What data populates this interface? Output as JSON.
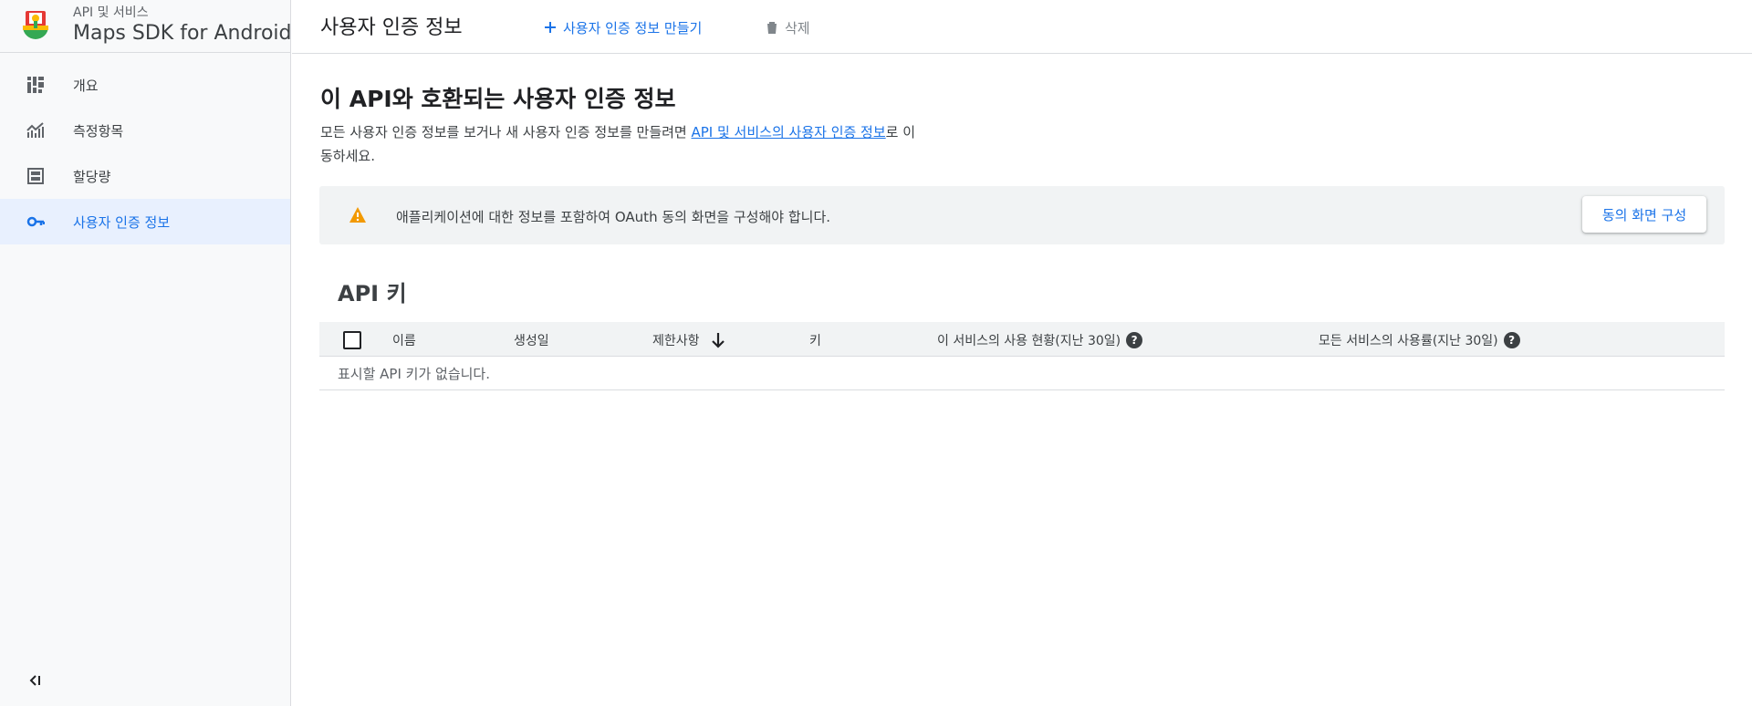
{
  "sidebar": {
    "kicker": "API 및 서비스",
    "title": "Maps SDK for Android",
    "items": [
      {
        "label": "개요",
        "icon": "dashboard-icon",
        "active": false
      },
      {
        "label": "측정항목",
        "icon": "metrics-icon",
        "active": false
      },
      {
        "label": "할당량",
        "icon": "quota-icon",
        "active": false
      },
      {
        "label": "사용자 인증 정보",
        "icon": "key-icon",
        "active": true
      }
    ],
    "collapse_icon": "collapse-sidebar-icon"
  },
  "header": {
    "title": "사용자 인증 정보",
    "create_label": "사용자 인증 정보 만들기",
    "delete_label": "삭제"
  },
  "main": {
    "heading_prefix": "이 ",
    "heading_api": "API",
    "heading_suffix": "와 호환되는 사용자 인증 정보",
    "intro_text": "모든 사용자 인증 정보를 보거나 새 사용자 인증 정보를 만들려면 ",
    "intro_link": "API 및 서비스의 사용자 인증 정보",
    "intro_suffix": "로 이동하세요."
  },
  "notice": {
    "text": "애플리케이션에 대한 정보를 포함하여 OAuth 동의 화면을 구성해야 합니다.",
    "button": "동의 화면 구성",
    "icon": "warning-icon"
  },
  "api_keys": {
    "heading": "API 키",
    "columns": [
      "이름",
      "생성일",
      "제한사항",
      "키",
      "이 서비스의 사용 현황(지난 30일)",
      "모든 서비스의 사용률(지난 30일)"
    ],
    "empty": "표시할 API 키가 없습니다."
  },
  "colors": {
    "accent": "#1a73e8",
    "warning": "#f29900",
    "sidebar_bg": "#f8f9fa",
    "active_bg": "#e8f0fe"
  }
}
